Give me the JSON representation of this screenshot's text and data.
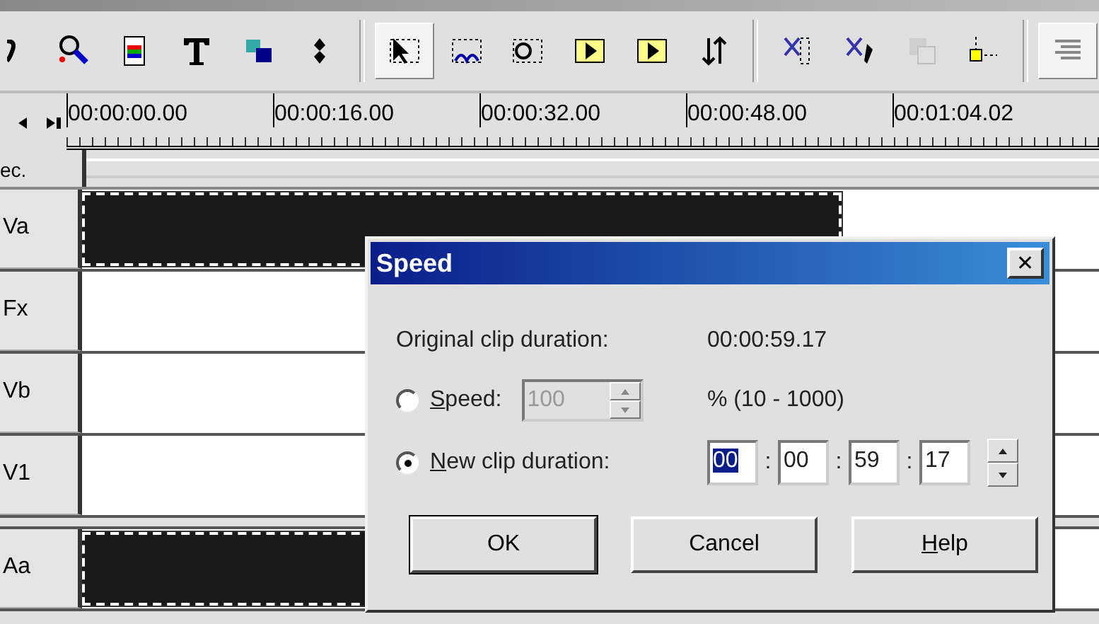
{
  "toolbar": [
    {
      "selected": false,
      "disabled": false
    },
    {
      "selected": false,
      "disabled": false
    },
    {
      "selected": false,
      "disabled": false
    },
    {
      "selected": false,
      "disabled": false
    },
    {
      "selected": false,
      "disabled": false
    },
    {
      "selected": false,
      "disabled": false
    },
    {
      "selected": true,
      "disabled": false
    },
    {
      "selected": false,
      "disabled": false
    },
    {
      "selected": false,
      "disabled": false
    },
    {
      "selected": false,
      "disabled": false
    },
    {
      "selected": false,
      "disabled": false
    },
    {
      "selected": false,
      "disabled": false
    },
    {
      "selected": false,
      "disabled": false
    },
    {
      "selected": false,
      "disabled": false
    },
    {
      "selected": false,
      "disabled": true
    },
    {
      "selected": false,
      "disabled": false
    },
    {
      "selected": true,
      "disabled": false
    }
  ],
  "ruler": [
    "00:00:00.00",
    "00:00:16.00",
    "00:00:32.00",
    "00:00:48.00",
    "00:01:04.02"
  ],
  "tracks": [
    {
      "label": "ec.",
      "kind": "header"
    },
    {
      "label": "Va",
      "kind": "track",
      "has_clip": true
    },
    {
      "label": "Fx",
      "kind": "track",
      "has_clip": false
    },
    {
      "label": "Vb",
      "kind": "track",
      "has_clip": false
    },
    {
      "label": "V1",
      "kind": "track",
      "has_clip": false
    },
    {
      "label": "Aa",
      "kind": "track",
      "has_clip": true
    }
  ],
  "dialog": {
    "title": "Speed",
    "close": "✕",
    "original_label": "Original clip duration:",
    "original_value": "00:00:59.17",
    "options": [
      {
        "key": "S",
        "rest": "peed:",
        "selected": false
      },
      {
        "key": "N",
        "rest": "ew clip duration:",
        "selected": true
      }
    ],
    "speed": {
      "value": "100",
      "disabled": true,
      "range": "% (10 - 1000)"
    },
    "duration": [
      {
        "value": "00",
        "selected": true
      },
      {
        "value": "00",
        "selected": false
      },
      {
        "value": "59",
        "selected": false
      },
      {
        "value": "17",
        "selected": false
      }
    ],
    "separator": ":",
    "buttons": [
      {
        "rest": "OK",
        "default": true
      },
      {
        "rest": "Cancel",
        "default": false
      },
      {
        "key": "H",
        "rest": "elp",
        "default": false
      }
    ]
  }
}
